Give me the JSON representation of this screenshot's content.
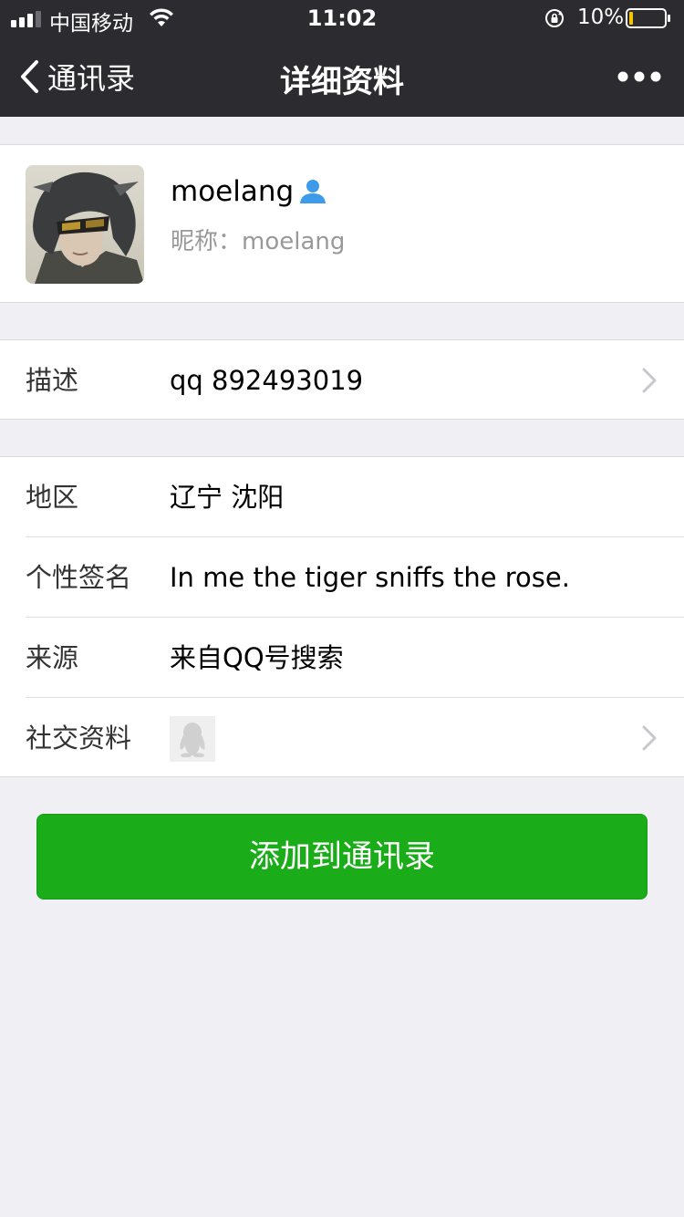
{
  "status_bar": {
    "carrier": "中国移动",
    "time": "11:02",
    "battery_percent": "10%",
    "battery_level": 0.1,
    "icons": [
      "signal-icon",
      "wifi-icon",
      "rotation-lock-icon",
      "battery-icon"
    ]
  },
  "nav": {
    "back_label": "通讯录",
    "title": "详细资料",
    "more_icon": "more-dots-icon"
  },
  "profile": {
    "name": "moelang",
    "nickname_label": "昵称：",
    "nickname": "moelang",
    "badge_icon": "person-icon"
  },
  "description": {
    "label": "描述",
    "value": "qq 892493019"
  },
  "details": [
    {
      "label": "地区",
      "value": "辽宁 沈阳"
    },
    {
      "label": "个性签名",
      "value": "In me the tiger sniffs the rose."
    },
    {
      "label": "来源",
      "value": "来自QQ号搜索"
    },
    {
      "label": "社交资料",
      "icon": "qq-penguin-icon"
    }
  ],
  "actions": {
    "add_contact": "添加到通讯录"
  },
  "colors": {
    "nav_bg": "#2b2b30",
    "page_bg": "#efeff4",
    "button_green": "#1aad19",
    "badge_blue": "#3d9be9"
  }
}
